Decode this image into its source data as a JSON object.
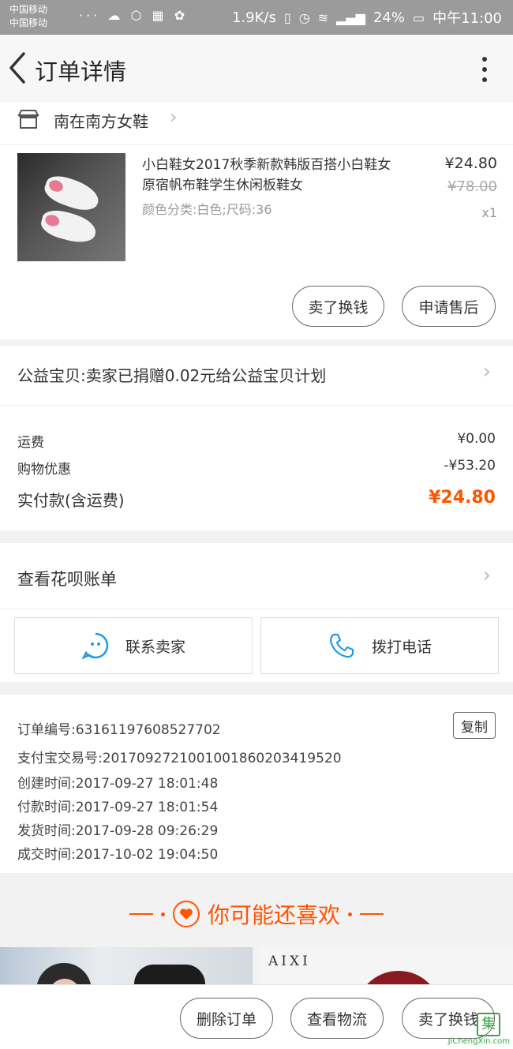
{
  "status_bar": {
    "carrier_1": "中国移动",
    "carrier_2": "中国移动",
    "net_speed": "1.9K/s",
    "battery": "24%",
    "time": "中午11:00"
  },
  "nav": {
    "title": "订单详情"
  },
  "shop": {
    "name": "南在南方女鞋"
  },
  "product": {
    "title": "小白鞋女2017秋季新款韩版百搭小白鞋女原宿帆布鞋学生休闲板鞋女",
    "sku": "颜色分类:白色;尺码:36",
    "price_now": "¥24.80",
    "price_old": "¥78.00",
    "quantity": "x1",
    "resell_label": "卖了换钱",
    "aftersale_label": "申请售后"
  },
  "charity": {
    "text": "公益宝贝:卖家已捐赠0.02元给公益宝贝计划"
  },
  "costs": {
    "shipping_label": "运费",
    "shipping_value": "¥0.00",
    "discount_label": "购物优惠",
    "discount_value": "-¥53.20",
    "paid_label": "实付款(含运费)",
    "paid_value": "¥24.80"
  },
  "huabei": {
    "label": "查看花呗账单"
  },
  "contact": {
    "seller_label": "联系卖家",
    "call_label": "拨打电话"
  },
  "order_info": {
    "order_no": "订单编号:63161197608527702",
    "alipay_no": "支付宝交易号:2017092721001001860203419520",
    "created": "创建时间:2017-09-27 18:01:48",
    "paid": "付款时间:2017-09-27 18:01:54",
    "shipped": "发货时间:2017-09-28 09:26:29",
    "completed": "成交时间:2017-10-02 19:04:50",
    "copy_label": "复制"
  },
  "recommend": {
    "header": "你可能还喜欢",
    "brand": "AIXI"
  },
  "bottom": {
    "delete_label": "删除订单",
    "logistics_label": "查看物流",
    "resell_label": "卖了换钱"
  },
  "watermark": {
    "logo_char": "集",
    "site": "JiChengXin.com"
  },
  "colors": {
    "accent": "#ff5500",
    "status_bar": "#9b9b9b",
    "contact_icon": "#1e9be8"
  }
}
